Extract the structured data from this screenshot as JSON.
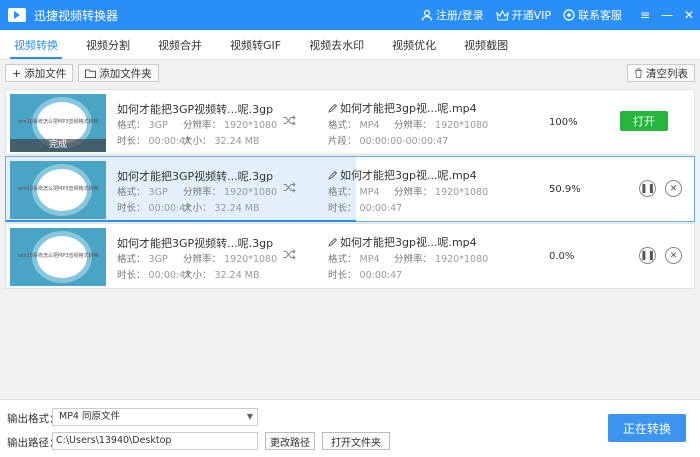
{
  "app": {
    "title": "迅捷视频转换器",
    "login": "注册/登录",
    "vip": "开通VIP",
    "support": "联系客服",
    "win_menu": "≡",
    "win_min": "—",
    "win_close": "✕"
  },
  "tabs": [
    "视频转换",
    "视频分割",
    "视频合并",
    "视频转GIF",
    "视频去水印",
    "视频优化",
    "视频截图"
  ],
  "toolbar": {
    "add_file": "添加文件",
    "add_folder": "添加文件夹",
    "clear_list": "清空列表"
  },
  "labels": {
    "format": "格式：",
    "resolution": "分辨率：",
    "duration": "时长：",
    "size": "大小：",
    "clip": "片段："
  },
  "tasks": [
    {
      "thumb_text": "win10系统怎么把MP3音频格式转换",
      "status_band": "完成",
      "src_name": "如何才能把3GP视频转...呢.3gp",
      "src_format": "3GP",
      "src_resolution": "1920*1080",
      "src_duration": "00:00:47",
      "src_size": "32.24 MB",
      "dst_name": "如何才能把3gp视...呢.mp4",
      "dst_format": "MP4",
      "dst_resolution": "1920*1080",
      "dst_clip": "00:00:00-00:00:47",
      "percent_text": "100%",
      "progress": 1.0,
      "open_label": "打开"
    },
    {
      "thumb_text": "win10系统怎么把MP3音频格式转换",
      "src_name": "如何才能把3GP视频转...呢.3gp",
      "src_format": "3GP",
      "src_resolution": "1920*1080",
      "src_duration": "00:00:47",
      "src_size": "32.24 MB",
      "dst_name": "如何才能把3gp视...呢.mp4",
      "dst_format": "MP4",
      "dst_resolution": "1920*1080",
      "dst_duration": "00:00:47",
      "percent_text": "50.9%",
      "progress": 0.509
    },
    {
      "thumb_text": "win10系统怎么把MP3音频格式转换",
      "src_name": "如何才能把3GP视频转...呢.3gp",
      "src_format": "3GP",
      "src_resolution": "1920*1080",
      "src_duration": "00:00:47",
      "src_size": "32.24 MB",
      "dst_name": "如何才能把3gp视...呢.mp4",
      "dst_format": "MP4",
      "dst_resolution": "1920*1080",
      "dst_duration": "00:00:47",
      "percent_text": "0.0%",
      "progress": 0.0
    }
  ],
  "bottom": {
    "format_label": "输出格式：",
    "format_value": "MP4   同原文件",
    "path_label": "输出路径：",
    "path_value": "C:\\Users\\13940\\Desktop",
    "change_path": "更改路径",
    "open_folder": "打开文件夹",
    "convert_label": "正在转换"
  },
  "colors": {
    "accent": "#2a8ef7",
    "open_button": "#27b53e"
  }
}
